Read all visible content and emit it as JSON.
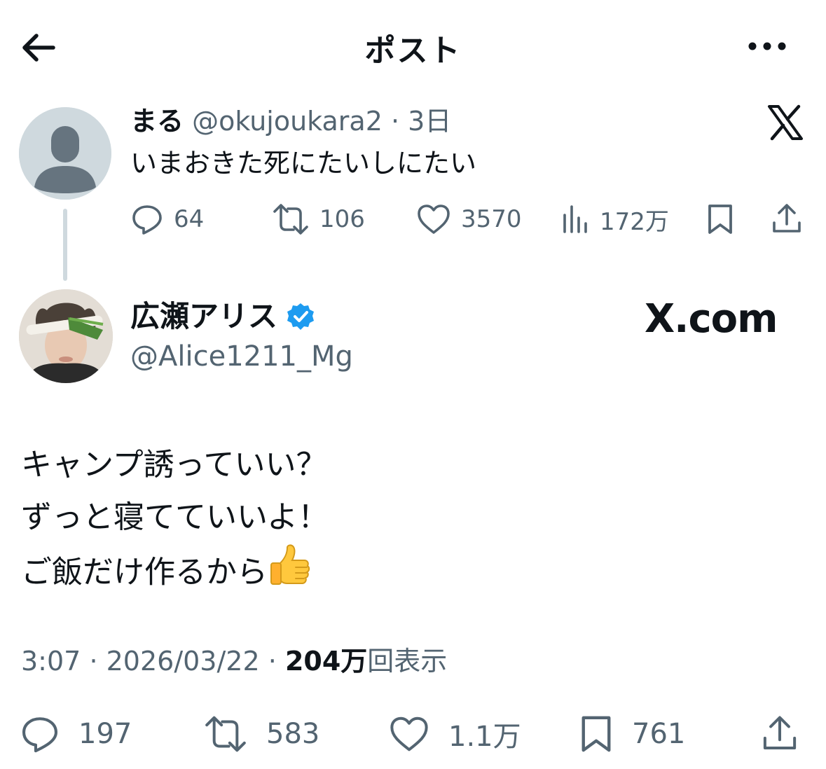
{
  "header": {
    "title": "ポスト",
    "back_icon": "back-arrow-icon",
    "more_icon": "more-dots-icon"
  },
  "quoted_post": {
    "display_name": "まる",
    "handle": "@okujoukara2",
    "separator": "·",
    "time": "3日",
    "text": "いまおきた死にたいしにたい",
    "actions": {
      "replies": "64",
      "reposts": "106",
      "likes": "3570",
      "views": "172万"
    }
  },
  "main_post": {
    "display_name": "広瀬アリス",
    "verified": true,
    "handle": "@Alice1211_Mg",
    "watermark": "X.com",
    "body_lines": [
      "キャンプ誘っていい？",
      "ずっと寝てていいよ！",
      "ご飯だけ作るから"
    ],
    "time": "3:07",
    "dot": "·",
    "date": "2026/03/22",
    "views_count": "204万",
    "views_label": "回表示",
    "actions": {
      "replies": "197",
      "reposts": "583",
      "likes": "1.1万",
      "bookmarks": "761"
    }
  },
  "colors": {
    "text": "#0f1419",
    "secondary": "#536471",
    "verified_blue": "#1d9bf0",
    "thread_line": "#cfd9de"
  }
}
